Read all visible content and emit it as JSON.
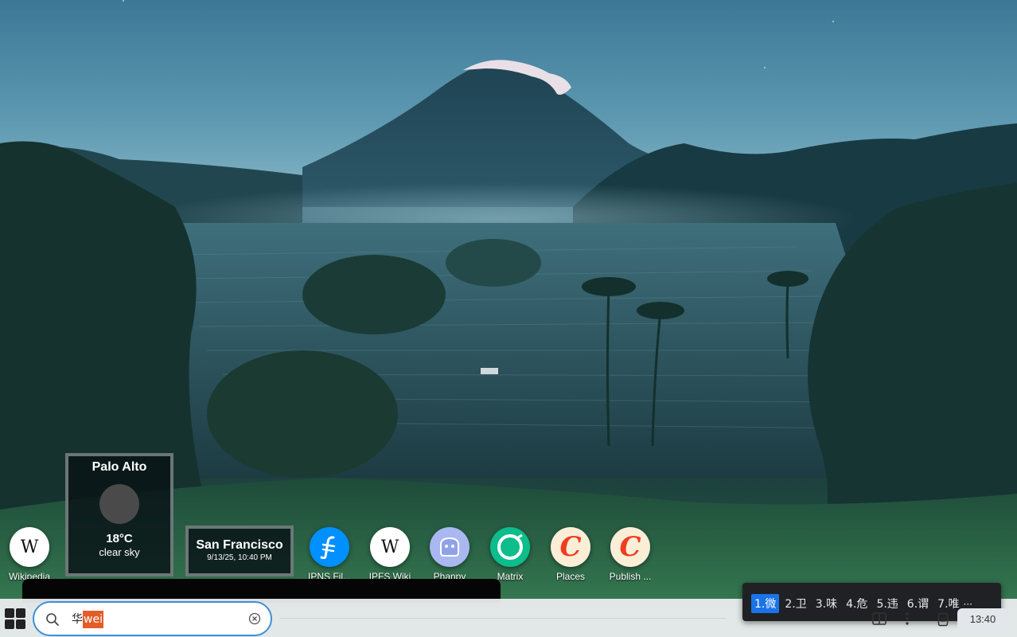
{
  "apps": [
    {
      "label": "Wikipedia",
      "icon": "wikipedia-icon"
    },
    {
      "label": "IPNS Fil...",
      "icon": "filecoin-icon"
    },
    {
      "label": "IPFS Wiki",
      "icon": "wikipedia-icon"
    },
    {
      "label": "Phanpy",
      "icon": "phanpy-icon"
    },
    {
      "label": "Matrix",
      "icon": "matrix-icon"
    },
    {
      "label": "Places",
      "icon": "places-c-icon"
    },
    {
      "label": "Publish ...",
      "icon": "publish-c-icon"
    }
  ],
  "weather": {
    "city": "Palo Alto",
    "temp": "18°C",
    "condition": "clear sky",
    "icon": "moon-icon"
  },
  "clock": {
    "city": "San Francisco",
    "datetime": "9/13/25, 10:40 PM"
  },
  "search": {
    "committed_text": "华",
    "composition_text": "wei",
    "icon": "search-icon",
    "clear_icon": "clear-icon"
  },
  "ime": {
    "candidates": [
      "1.微",
      "2.卫",
      "3.味",
      "4.危",
      "5.违",
      "6.谓",
      "7.唯"
    ],
    "selected_index": 0,
    "more": "···"
  },
  "tray": {
    "time": "13:40"
  },
  "colors": {
    "search_border": "#3f8fd6",
    "composition_bg": "#e35d2b",
    "ime_selected": "#1a73e8",
    "ime_bg": "#202124"
  }
}
